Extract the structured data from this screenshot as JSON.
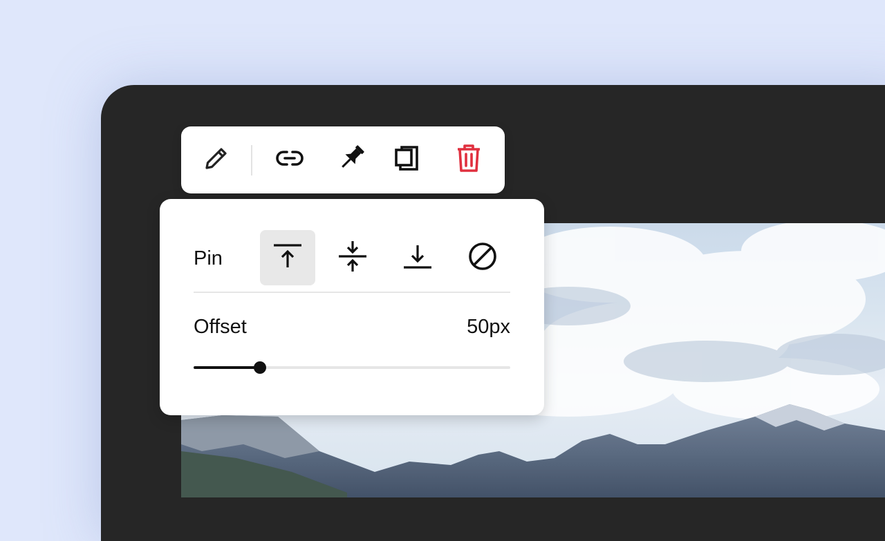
{
  "toolbar": {
    "buttons": [
      {
        "icon": "pencil-icon"
      },
      {
        "icon": "link-icon"
      },
      {
        "icon": "pin-icon"
      },
      {
        "icon": "duplicate-icon"
      },
      {
        "icon": "trash-icon"
      }
    ],
    "delete_color": "#e0303f"
  },
  "pin_panel": {
    "pin_label": "Pin",
    "options": [
      {
        "icon": "pin-top-icon",
        "selected": true
      },
      {
        "icon": "pin-center-icon",
        "selected": false
      },
      {
        "icon": "pin-bottom-icon",
        "selected": false
      },
      {
        "icon": "no-pin-icon",
        "selected": false
      }
    ],
    "offset_label": "Offset",
    "offset_value": "50px",
    "offset_fraction": 0.21
  },
  "colors": {
    "background": "#dfe7fb",
    "device": "#262626",
    "panel": "#ffffff",
    "accent": "#111111"
  }
}
